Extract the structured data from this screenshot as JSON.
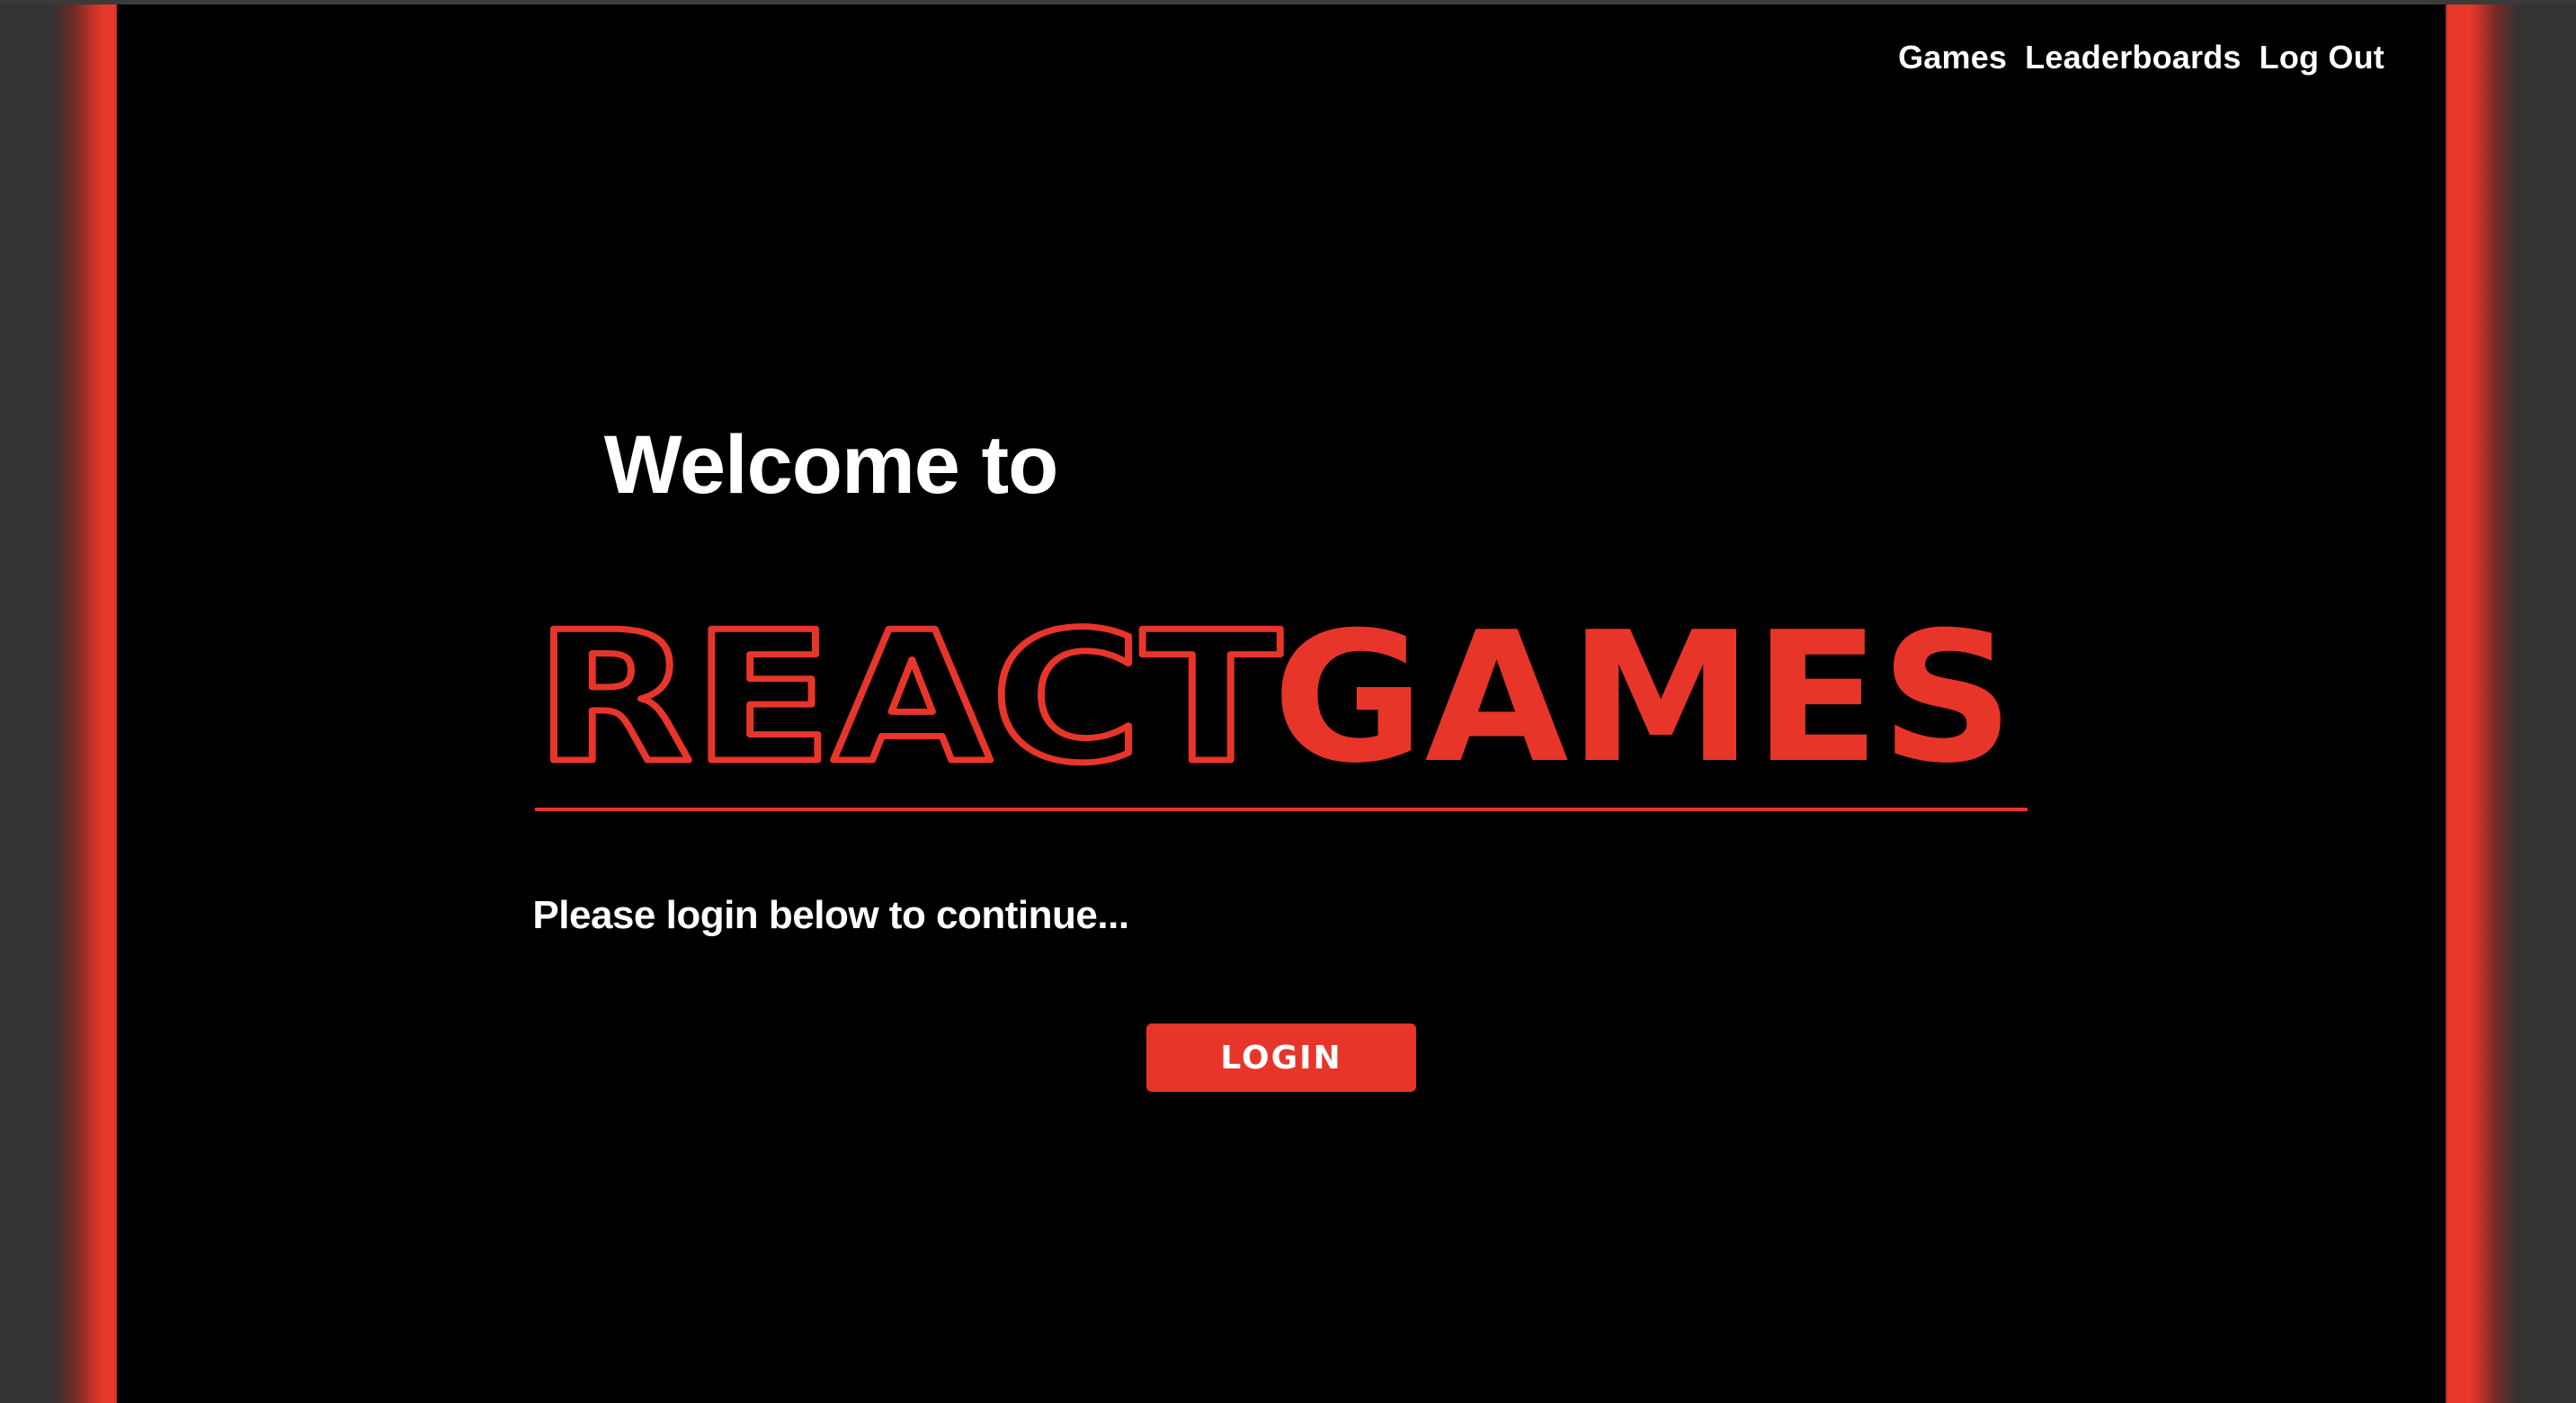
{
  "nav": {
    "items": [
      {
        "label": "Games"
      },
      {
        "label": "Leaderboards"
      },
      {
        "label": "Log Out"
      }
    ]
  },
  "hero": {
    "welcome": "Welcome to",
    "logo_react": "REACT",
    "logo_games": "GAMES",
    "subtitle": "Please login below to continue...",
    "login_label": "LOGIN"
  },
  "colors": {
    "accent": "#e8352a",
    "background": "#000000",
    "frame": "#333333",
    "text": "#ffffff"
  }
}
